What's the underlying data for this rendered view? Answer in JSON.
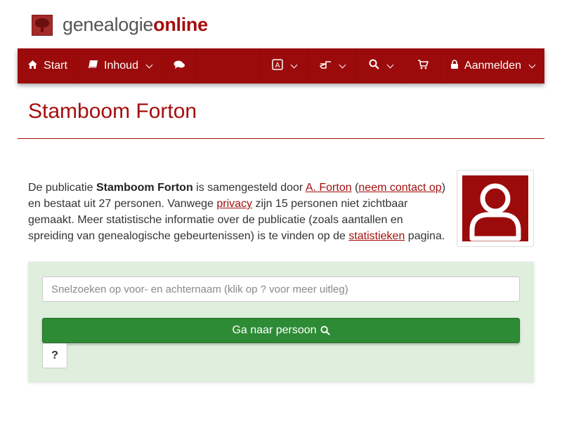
{
  "site": {
    "logo_part1": "genealogie",
    "logo_part2": "online"
  },
  "nav": {
    "start": "Start",
    "inhoud": "Inhoud",
    "aanmelden": "Aanmelden",
    "icons": [
      "home-icon",
      "book-icon",
      "comments-icon",
      "language-icon",
      "hand-pointer-icon",
      "search-icon",
      "cart-icon",
      "lock-icon"
    ]
  },
  "page": {
    "title": "Stamboom Forton",
    "intro": {
      "t1": "De publicatie ",
      "pub": "Stamboom Forton",
      "t2": " is samengesteld door ",
      "author": "A. Forton",
      "t3": " (",
      "contact": "neem contact op",
      "t4": ") en bestaat uit 27 personen. Vanwege ",
      "privacy": "privacy",
      "t5": " zijn 15 personen niet zichtbaar gemaakt. Meer statistische informatie over de publicatie (zoals aantallen en spreiding van genealogische gebeurtenissen) is te vinden op de ",
      "stats": "statistieken",
      "t6": " pagina."
    }
  },
  "search": {
    "placeholder": "Snelzoeken op voor- en achternaam (klik op ? voor meer uitleg)",
    "go_label": "Ga naar persoon",
    "help_label": "?"
  },
  "colors": {
    "brand": "#9c0b0b",
    "go_button": "#2e8b35",
    "panel": "#dfeedd"
  }
}
